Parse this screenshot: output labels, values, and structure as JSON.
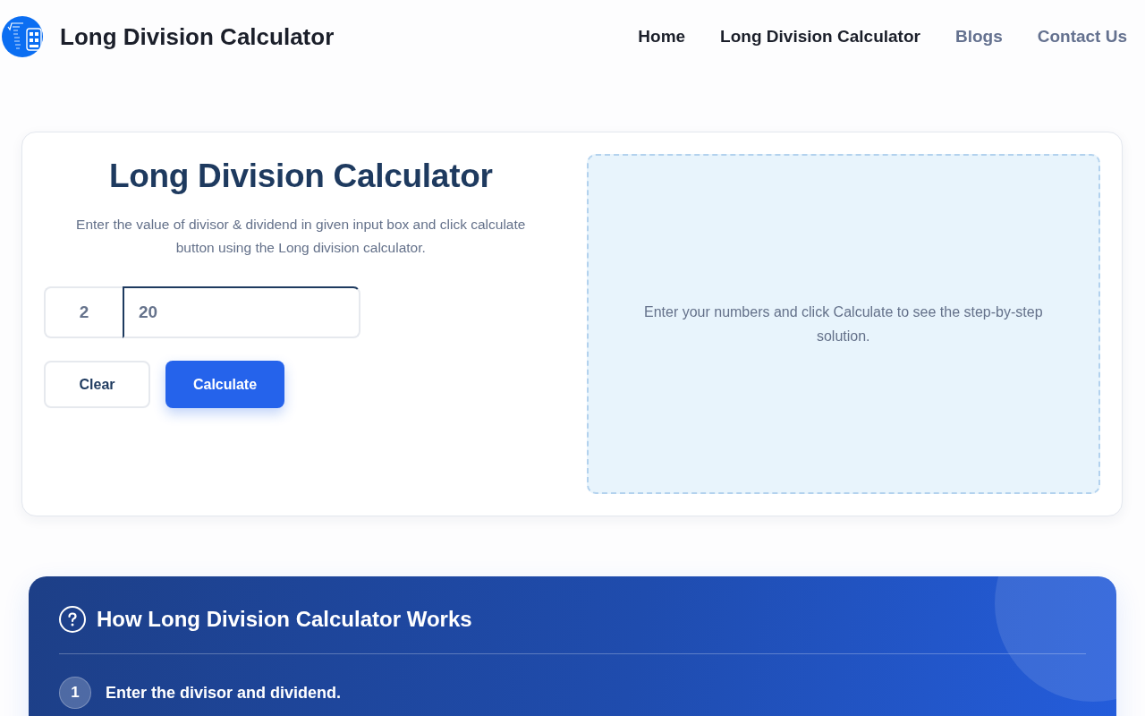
{
  "header": {
    "brand": "Long Division Calculator",
    "nav": [
      {
        "label": "Home",
        "selected": true
      },
      {
        "label": "Long Division Calculator",
        "selected": true
      },
      {
        "label": "Blogs",
        "selected": false
      },
      {
        "label": "Contact Us",
        "selected": false
      }
    ]
  },
  "calculator": {
    "title": "Long Division Calculator",
    "description": "Enter the value of divisor & dividend in given input box and click calculate button using the Long division calculator.",
    "divisor": {
      "value": "2",
      "focused": false
    },
    "dividend": {
      "value": "20",
      "focused": true
    },
    "buttons": [
      {
        "label": "Clear",
        "kind": "secondary"
      },
      {
        "label": "Calculate",
        "kind": "primary"
      }
    ],
    "result_message": "Enter your numbers and click Calculate to see the step-by-step solution."
  },
  "how_it_works": {
    "title": "How Long Division Calculator Works",
    "steps": [
      {
        "number": "1",
        "text": "Enter the divisor and dividend."
      }
    ]
  }
}
